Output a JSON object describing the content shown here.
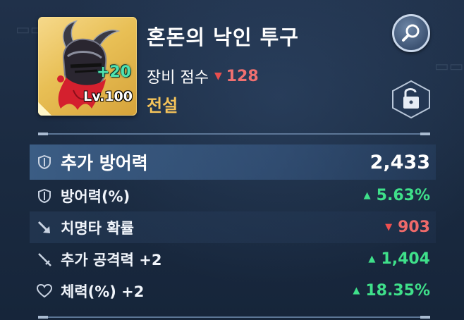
{
  "item": {
    "name": "혼돈의 낙인 투구",
    "enhance": "+20",
    "level": "Lv.100",
    "score_label": "장비 점수",
    "score_value": "128",
    "grade": "전설",
    "helmet_colors": {
      "dark": "#2a2630",
      "accent": "#d4202e"
    }
  },
  "buttons": {
    "magnify_icon": "magnifier-icon",
    "lock_icon": "unlock-icon"
  },
  "stats": [
    {
      "label": "추가 방어력",
      "value": "2,433",
      "icon": "shield-icon",
      "trend": "none"
    },
    {
      "label": "방어력(%)",
      "value": "5.63%",
      "icon": "shield-icon",
      "trend": "up"
    },
    {
      "label": "치명타 확률",
      "value": "903",
      "icon": "crit-arrow-icon",
      "trend": "down"
    },
    {
      "label": "추가 공격력 +2",
      "value": "1,404",
      "icon": "sword-icon",
      "trend": "up"
    },
    {
      "label": "체력(%) +2",
      "value": "18.35%",
      "icon": "heart-icon",
      "trend": "up"
    }
  ],
  "colors": {
    "up": "#3fe08a",
    "down": "#ef6a6a",
    "grade": "#f4c35a",
    "frame": "#e8bf55"
  }
}
